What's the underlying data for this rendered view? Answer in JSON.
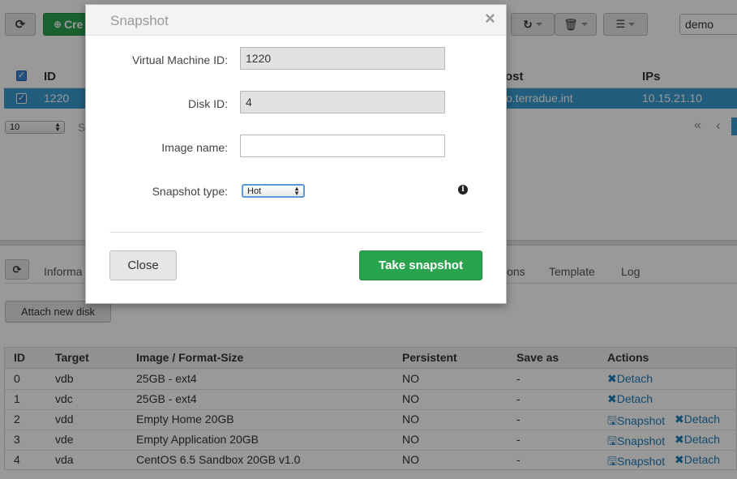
{
  "toolbar": {
    "create_label": "Cre",
    "user_select_value": "demo"
  },
  "vm_table": {
    "columns": [
      "ID",
      "Host",
      "IPs"
    ],
    "host_header_partial": "ost",
    "row": {
      "id": "1220",
      "host_partial": "glio.terradue.int",
      "ips": "10.15.21.10"
    },
    "page_size": "10",
    "info_partial": "S",
    "pager_first": "«",
    "pager_prev": "‹"
  },
  "detail_tabs": {
    "items": [
      "Informa",
      "ions",
      "Template",
      "Log"
    ]
  },
  "disks": {
    "attach_label": "Attach new disk",
    "headers": [
      "ID",
      "Target",
      "Image / Format-Size",
      "Persistent",
      "Save as",
      "Actions"
    ],
    "rows": [
      {
        "id": "0",
        "target": "vdb",
        "image": "25GB - ext4",
        "persistent": "NO",
        "save_as": "-",
        "snapshot": "",
        "detach": "Detach"
      },
      {
        "id": "1",
        "target": "vdc",
        "image": "25GB - ext4",
        "persistent": "NO",
        "save_as": "-",
        "snapshot": "",
        "detach": "Detach"
      },
      {
        "id": "2",
        "target": "vdd",
        "image": "Empty Home 20GB",
        "persistent": "NO",
        "save_as": "-",
        "snapshot": "Snapshot",
        "detach": "Detach"
      },
      {
        "id": "3",
        "target": "vde",
        "image": "Empty Application 20GB",
        "persistent": "NO",
        "save_as": "-",
        "snapshot": "Snapshot",
        "detach": "Detach"
      },
      {
        "id": "4",
        "target": "vda",
        "image": "CentOS 6.5 Sandbox 20GB v1.0",
        "persistent": "NO",
        "save_as": "-",
        "snapshot": "Snapshot",
        "detach": "Detach"
      }
    ]
  },
  "modal": {
    "title": "Snapshot",
    "close_x": "×",
    "vm_id_label": "Virtual Machine ID:",
    "vm_id_value": "1220",
    "disk_id_label": "Disk ID:",
    "disk_id_value": "4",
    "image_name_label": "Image name:",
    "image_name_value": "",
    "snapshot_type_label": "Snapshot type:",
    "snapshot_type_value": "Hot",
    "close_button": "Close",
    "take_button": "Take snapshot"
  },
  "colors": {
    "selected_row": "#3a9bd1",
    "green": "#2aa34f",
    "link": "#1f7db8"
  }
}
